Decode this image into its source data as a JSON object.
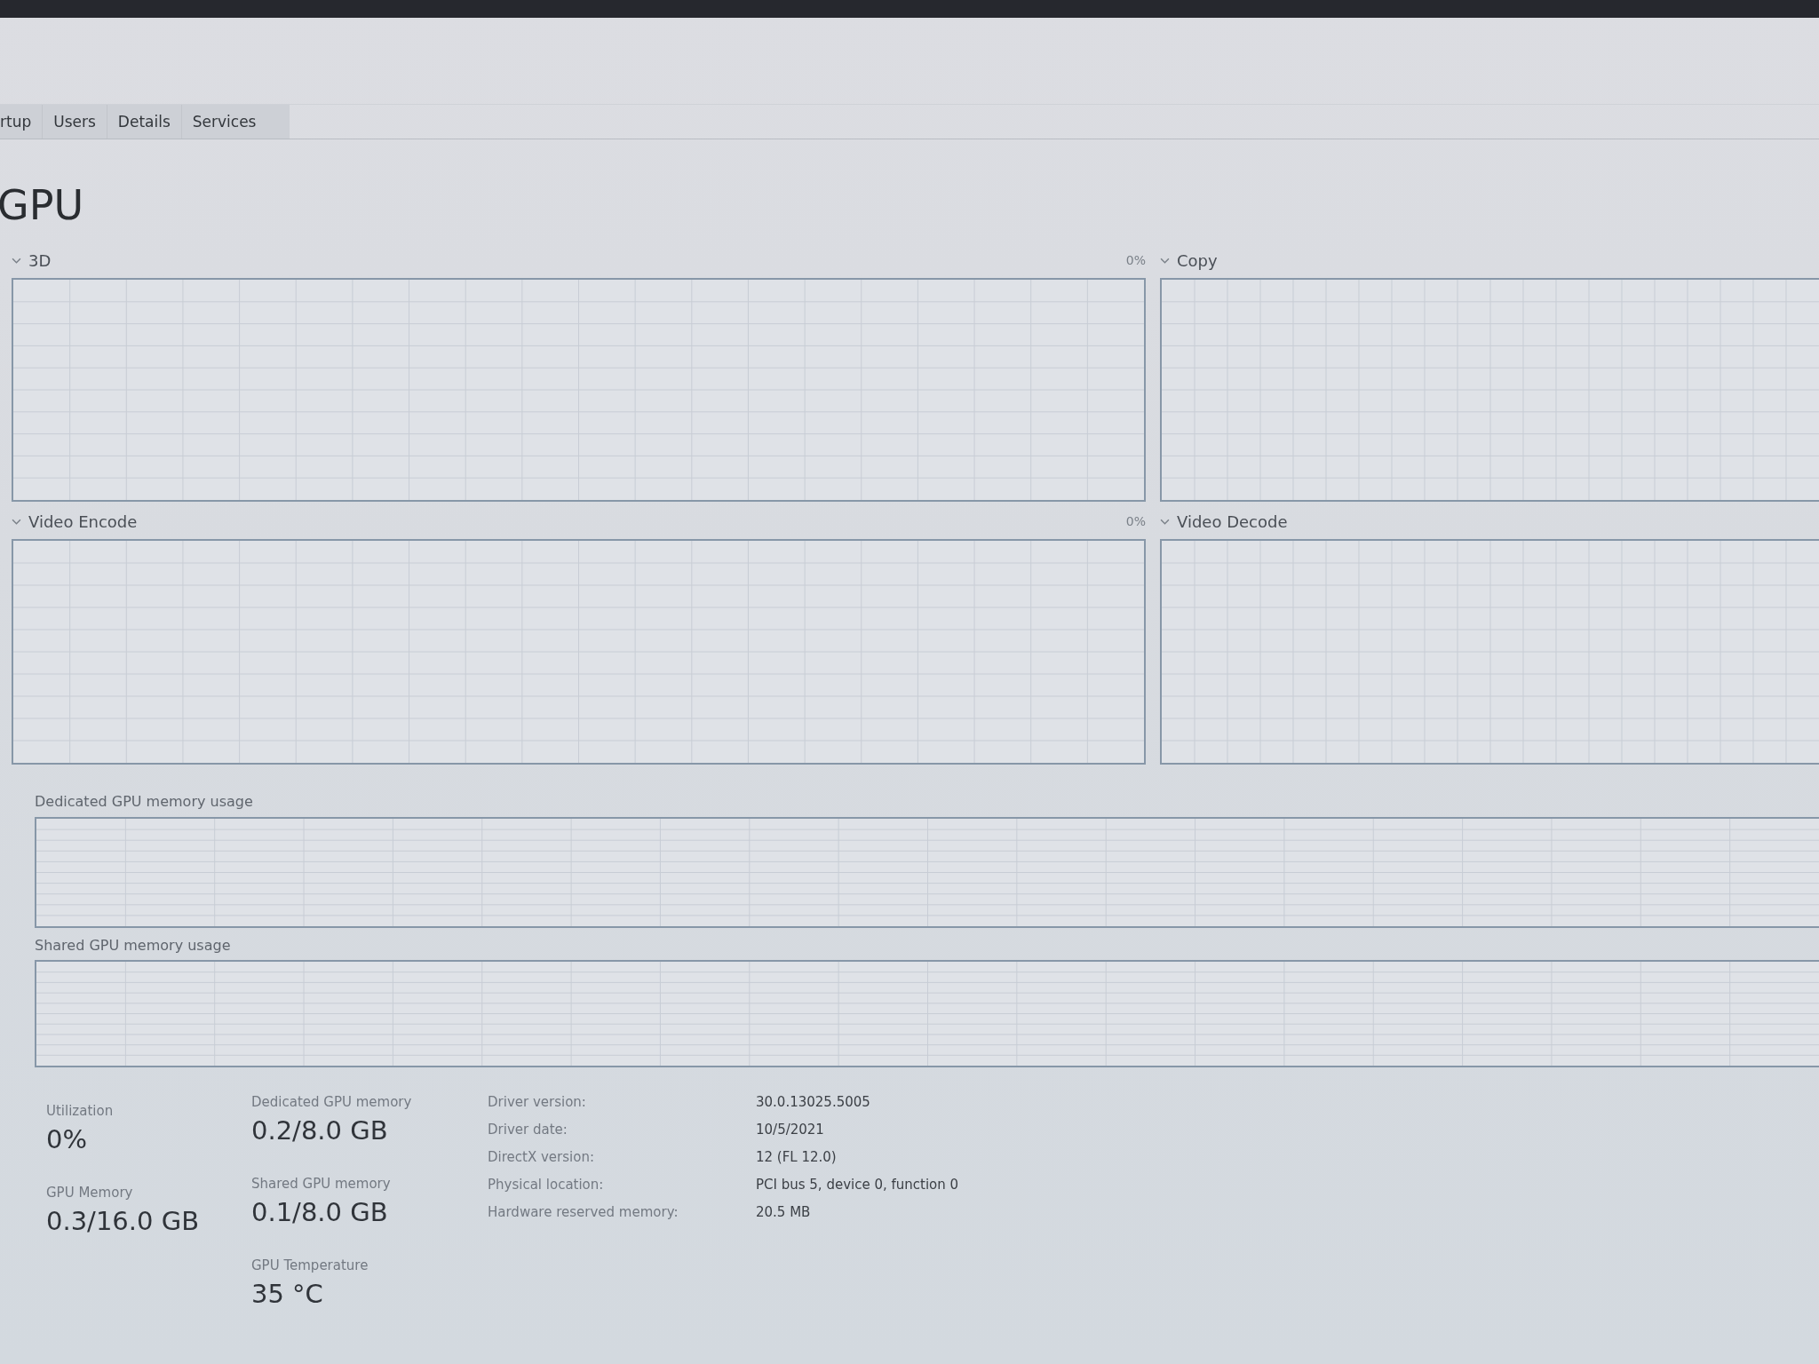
{
  "tabs": [
    {
      "label": "rtup",
      "selected": false
    },
    {
      "label": "Users",
      "selected": false
    },
    {
      "label": "Details",
      "selected": false
    },
    {
      "label": "Services",
      "selected": false
    }
  ],
  "title": "GPU",
  "engines": [
    {
      "name": "3D",
      "reading": "0%"
    },
    {
      "name": "Copy"
    },
    {
      "name": "Video Encode",
      "reading": "0%"
    },
    {
      "name": "Video Decode"
    }
  ],
  "memory_graphs": [
    {
      "label": "Dedicated GPU memory usage"
    },
    {
      "label": "Shared GPU memory usage"
    }
  ],
  "stat_columns": [
    [
      {
        "label": "Utilization",
        "value": "0%"
      },
      {
        "label": "GPU Memory",
        "value": "0.3/16.0 GB"
      }
    ],
    [
      {
        "label": "Dedicated GPU memory",
        "value": "0.2/8.0 GB"
      },
      {
        "label": "Shared GPU memory",
        "value": "0.1/8.0 GB"
      },
      {
        "label": "GPU Temperature",
        "value": "35 °C"
      }
    ]
  ],
  "details": [
    {
      "label": "Driver version:",
      "value": "30.0.13025.5005"
    },
    {
      "label": "Driver date:",
      "value": "10/5/2021"
    },
    {
      "label": "DirectX version:",
      "value": "12 (FL 12.0)"
    },
    {
      "label": "Physical location:",
      "value": "PCI bus 5, device 0, function 0"
    },
    {
      "label": "Hardware reserved memory:",
      "value": "20.5 MB"
    }
  ]
}
